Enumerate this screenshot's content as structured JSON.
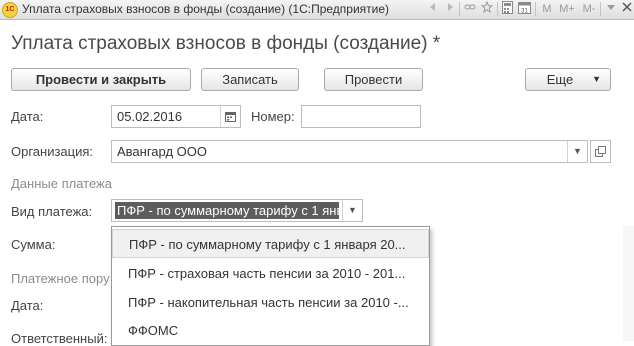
{
  "window": {
    "app_icon": "1c-logo-icon",
    "title": "Уплата страховых взносов в фонды (создание)  (1С:Предприятие)",
    "toolbar": [
      "M",
      "M+",
      "M-"
    ]
  },
  "form": {
    "title": "Уплата страховых взносов в фонды (создание) *",
    "buttons": {
      "post_and_close": "Провести и закрыть",
      "save": "Записать",
      "post": "Провести",
      "more": "Еще"
    },
    "date_label": "Дата:",
    "date_value": "05.02.2016",
    "number_label": "Номер:",
    "number_value": "",
    "org_label": "Организация:",
    "org_value": "Авангард ООО",
    "payment_group": "Данные платежа",
    "payment_type_label": "Вид платежа:",
    "payment_type_value": "ПФР - по суммарному тарифу с 1 янв",
    "sum_label": "Сумма:",
    "payment_order_group": "Платежное пору",
    "date2_label": "Дата:",
    "responsible_label": "Ответственный:"
  },
  "dropdown": {
    "items": [
      "ПФР - по суммарному тарифу с 1 января 20...",
      "ПФР - страховая часть пенсии за 2010 - 201...",
      "ПФР - накопительная часть пенсии за 2010 -...",
      "ФФОМС"
    ],
    "selected_index": 0
  }
}
